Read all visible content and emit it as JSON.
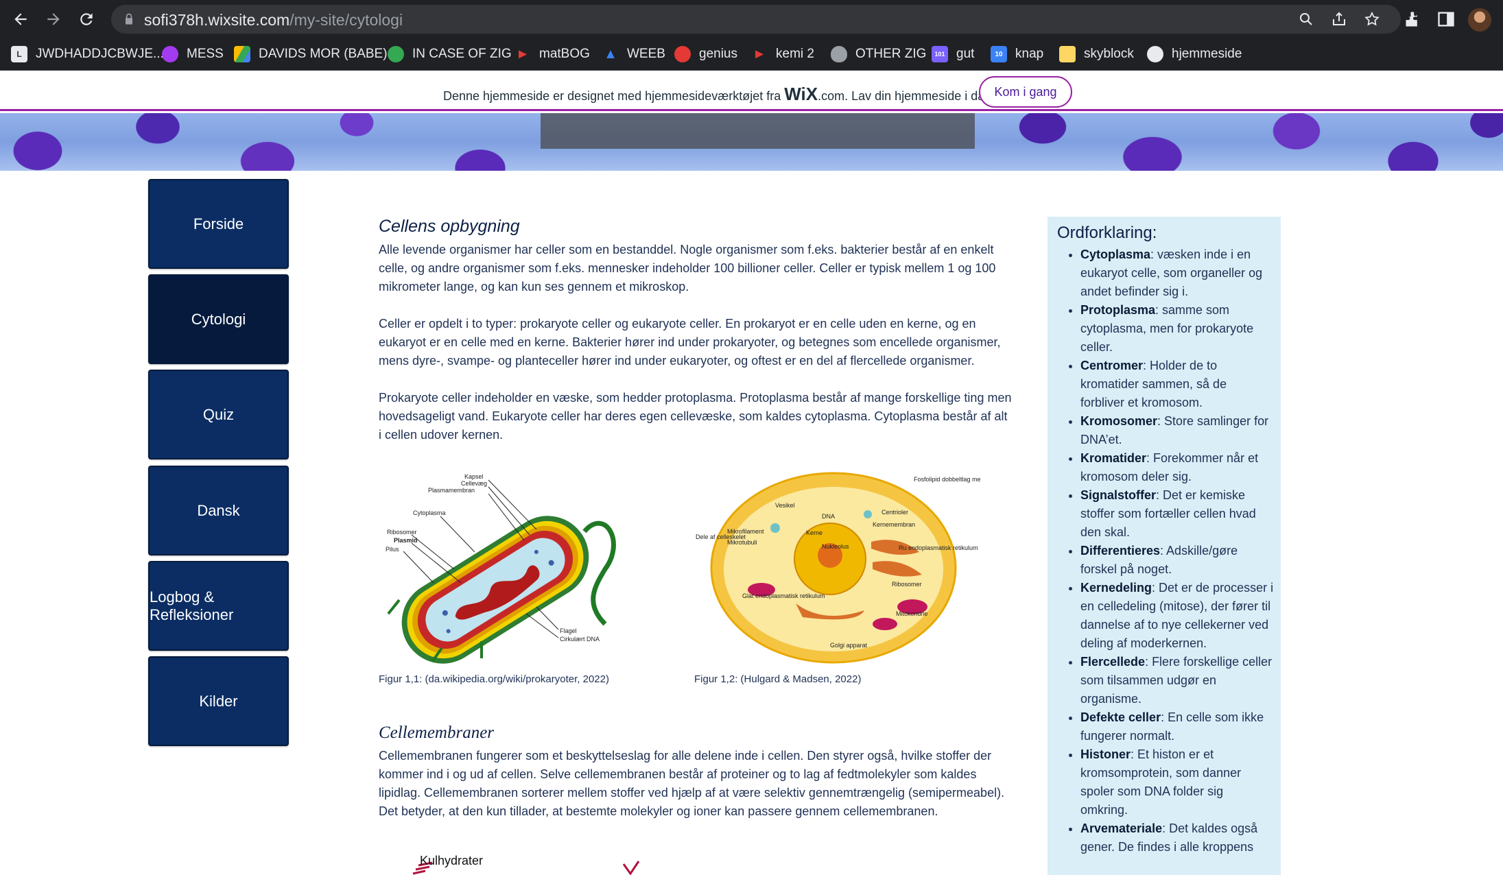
{
  "browser": {
    "url_host": "sofi378h.wixsite.com",
    "url_path": "/my-site/cytologi",
    "bookmarks": [
      {
        "label": "JWDHADDJCBWJE...",
        "icon": "L",
        "color": "#e8eaed"
      },
      {
        "label": "MESS",
        "icon": "messenger-icon",
        "color": "#a33bf0"
      },
      {
        "label": "DAVIDS MOR (BABE)",
        "icon": "drive-icon",
        "color": "#fbbc04"
      },
      {
        "label": "IN CASE OF ZIG",
        "icon": "circle-icon",
        "color": "#34a853"
      },
      {
        "label": "matBOG",
        "icon": "arrow-icon",
        "color": "#e53935"
      },
      {
        "label": "WEEB",
        "icon": "play-icon",
        "color": "#3b82f6"
      },
      {
        "label": "genius",
        "icon": "circle-icon",
        "color": "#e53935"
      },
      {
        "label": "kemi 2",
        "icon": "arrow-icon",
        "color": "#e53935"
      },
      {
        "label": "OTHER ZIG",
        "icon": "apple-icon",
        "color": "#9aa0a6"
      },
      {
        "label": "gut",
        "icon": "101",
        "color": "#7b61ff"
      },
      {
        "label": "knap",
        "icon": "10",
        "color": "#3b82f6"
      },
      {
        "label": "skyblock",
        "icon": "note-icon",
        "color": "#fdd663"
      },
      {
        "label": "hjemmeside",
        "icon": "globe-icon",
        "color": "#e8eaed"
      }
    ]
  },
  "wix_banner": {
    "text_before": "Denne hjemmeside er designet med hjemmesideværktøjet fra",
    "logo": "WiX",
    "text_after": ".com. Lav din hjemmeside i dag.",
    "cta": "Kom i gang"
  },
  "nav": {
    "items": [
      "Forside",
      "Cytologi",
      "Quiz",
      "Dansk",
      "Logbog & Refleksioner",
      "Kilder"
    ],
    "active": "Cytologi"
  },
  "section1": {
    "title": "Cellens opbygning",
    "paragraphs": [
      "Alle levende organismer har celler som en bestanddel. Nogle organismer som f.eks. bakterier består af en enkelt celle, og andre organismer som f.eks. mennesker indeholder 100 billioner celler. Celler er typisk mellem 1 og 100 mikrometer lange, og kan kun ses gennem et mikroskop.",
      "Celler er opdelt i to typer: prokaryote celler og eukaryote celler. En prokaryot er en celle uden en kerne, og en eukaryot er en celle med en kerne. Bakterier hører ind under prokaryoter, og betegnes som encellede organismer, mens dyre-, svampe- og planteceller hører ind under eukaryoter, og oftest er en del af flercellede organismer.",
      "Prokaryote celler indeholder en væske, som hedder protoplasma. Protoplasma består af mange forskellige ting men hovedsageligt vand. Eukaryote celler har deres egen cellevæske, som kaldes cytoplasma. Cytoplasma består af alt i cellen udover kernen."
    ]
  },
  "figures": {
    "fig1": {
      "caption": "Figur 1,1: (da.wikipedia.org/wiki/prokaryoter, 2022)",
      "labels": [
        "Kapsel",
        "Cellevæg",
        "Plasmamembran",
        "Cytoplasma",
        "Ribosomer",
        "Plasmid",
        "Pilus",
        "Flagel",
        "Cirkulært DNA"
      ]
    },
    "fig2": {
      "caption": "Figur 1,2: (Hulgard & Madsen, 2022)",
      "labels": [
        "Fosfolipid dobbeltlag membran",
        "Vesikel",
        "DNA",
        "Centrioler",
        "Kernemembran",
        "Dele af celleskelet",
        "Mikrofilament",
        "Mikrotubuli",
        "Kerne",
        "Nukleolus",
        "Ru endoplasmatisk retikulum",
        "Glat endoplasmatisk retikulum",
        "Ribosomer",
        "Mitokondrie",
        "Golgi apparat"
      ]
    }
  },
  "section2": {
    "title": "Cellemembraner",
    "paragraph": "Cellemembranen fungerer som et beskyttelseslag for alle delene inde i cellen. Den styrer også, hvilke stoffer der kommer ind i og ud af cellen. Selve cellemembranen består af proteiner og to lag af fedtmolekyler som kaldes lipidlag. Cellemembranen sorterer mellem stoffer ved hjælp af at være selektiv gennemtrængelig (semipermeabel). Det betyder, at den kun tillader, at bestemte molekyler og ioner kan passere gennem cellemembranen.",
    "image_label": "Kulhydrater"
  },
  "glossary": {
    "title": "Ordforklaring",
    "items": [
      {
        "term": "Cytoplasma",
        "def": ": væsken inde i en eukaryot celle, som organeller og andet befinder sig i."
      },
      {
        "term": "Protoplasma",
        "def": ": samme som cytoplasma, men for prokaryote celler."
      },
      {
        "term": "Centromer",
        "def": ": Holder de to kromatider sammen, så de forbliver et kromosom."
      },
      {
        "term": "Kromosomer",
        "def": ": Store samlinger for DNA’et."
      },
      {
        "term": "Kromatider",
        "def": ": Forekommer når et kromosom deler sig."
      },
      {
        "term": "Signalstoffer",
        "def": ": Det er kemiske stoffer som fortæller cellen hvad den skal."
      },
      {
        "term": "Differentieres",
        "def": ": Adskille/gøre forskel på noget."
      },
      {
        "term": "Kernedeling",
        "def": ": Det er de processer i en celledeling (mitose), der fører til dannelse af to nye cellekerner ved deling af moderkernen."
      },
      {
        "term": "Flercellede",
        "def": ": Flere forskellige celler som tilsammen udgør en organisme."
      },
      {
        "term": "Defekte celler",
        "def": ": En celle som ikke fungerer normalt."
      },
      {
        "term": "Histoner",
        "def": ": Et histon er et kromsomprotein, som danner spoler som DNA folder sig omkring."
      },
      {
        "term": "Arvemateriale",
        "def": ": Det kaldes også gener. De findes i alle kroppens"
      }
    ]
  }
}
